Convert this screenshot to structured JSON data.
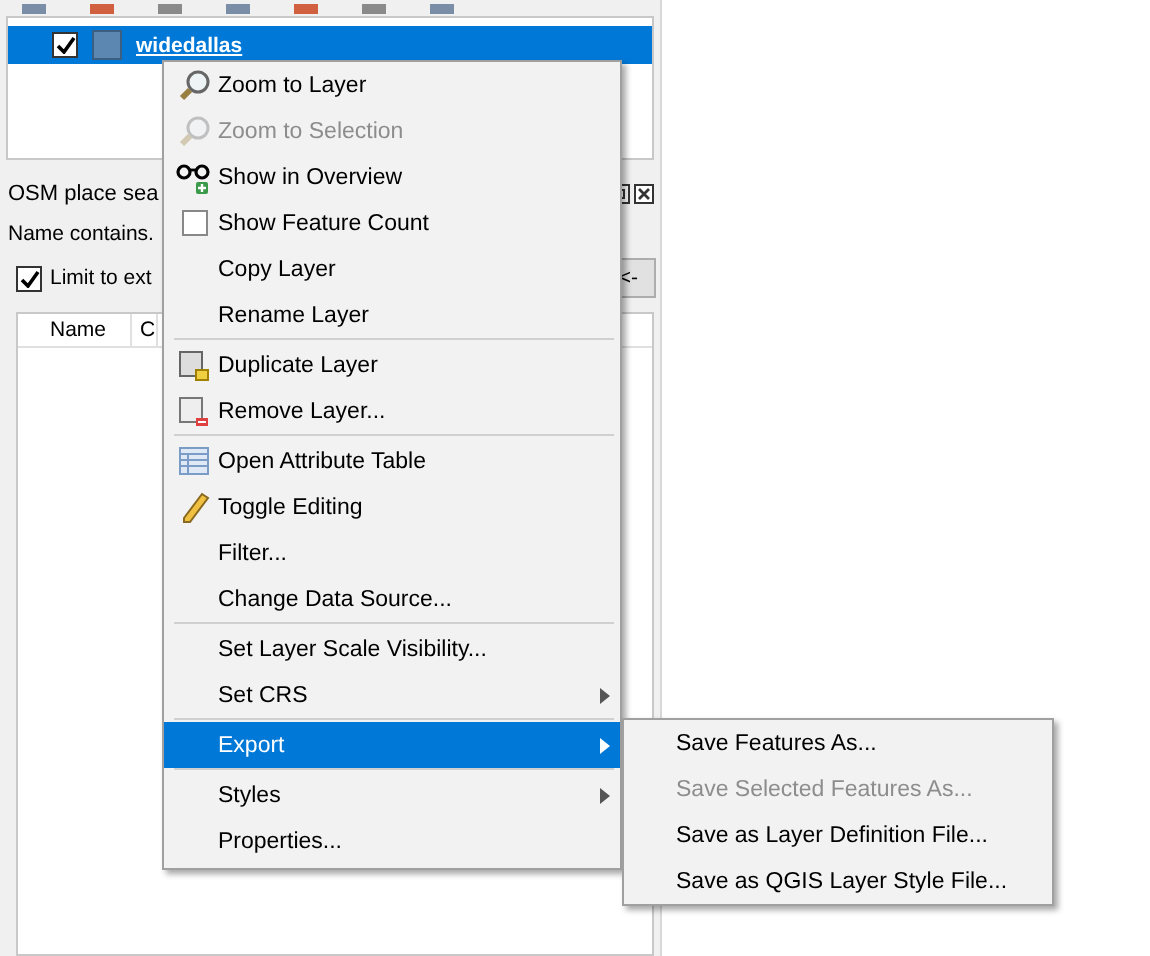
{
  "layers": [
    {
      "name": "widedallas",
      "checked": true,
      "selected": true,
      "color": "#5b87b0"
    }
  ],
  "dock": {
    "title": "OSM place sea",
    "label": "Name contains.",
    "limit": {
      "label": "Limit to ext",
      "checked": true
    },
    "button": "<-",
    "columns": [
      "Name",
      "C"
    ]
  },
  "context_menu": {
    "items": [
      {
        "kind": "action",
        "label": "Zoom to Layer",
        "disabled": false,
        "selected": false
      },
      {
        "kind": "action",
        "label": "Zoom to Selection",
        "disabled": true,
        "selected": false
      },
      {
        "kind": "action",
        "label": "Show in Overview",
        "disabled": false,
        "selected": false
      },
      {
        "kind": "checkbox",
        "label": "Show Feature Count",
        "checked": false,
        "disabled": false,
        "selected": false
      },
      {
        "kind": "action",
        "label": "Copy Layer",
        "disabled": false,
        "selected": false
      },
      {
        "kind": "action",
        "label": "Rename Layer",
        "disabled": false,
        "selected": false
      },
      {
        "kind": "separator"
      },
      {
        "kind": "action",
        "label": "Duplicate Layer",
        "disabled": false,
        "selected": false
      },
      {
        "kind": "action",
        "label": "Remove Layer...",
        "disabled": false,
        "selected": false
      },
      {
        "kind": "separator"
      },
      {
        "kind": "action",
        "label": "Open Attribute Table",
        "disabled": false,
        "selected": false
      },
      {
        "kind": "action",
        "label": "Toggle Editing",
        "disabled": false,
        "selected": false
      },
      {
        "kind": "action",
        "label": "Filter...",
        "disabled": false,
        "selected": false
      },
      {
        "kind": "action",
        "label": "Change Data Source...",
        "disabled": false,
        "selected": false
      },
      {
        "kind": "separator"
      },
      {
        "kind": "action",
        "label": "Set Layer Scale Visibility...",
        "disabled": false,
        "selected": false
      },
      {
        "kind": "submenu",
        "label": "Set CRS",
        "disabled": false,
        "selected": false
      },
      {
        "kind": "separator"
      },
      {
        "kind": "submenu",
        "label": "Export",
        "disabled": false,
        "selected": true
      },
      {
        "kind": "separator"
      },
      {
        "kind": "submenu",
        "label": "Styles",
        "disabled": false,
        "selected": false
      },
      {
        "kind": "action",
        "label": "Properties...",
        "disabled": false,
        "selected": false
      }
    ]
  },
  "submenu": {
    "items": [
      {
        "label": "Save Features As...",
        "disabled": false
      },
      {
        "label": "Save Selected Features As...",
        "disabled": true
      },
      {
        "label": "Save as Layer Definition File...",
        "disabled": false
      },
      {
        "label": "Save as QGIS Layer Style File...",
        "disabled": false
      }
    ]
  }
}
